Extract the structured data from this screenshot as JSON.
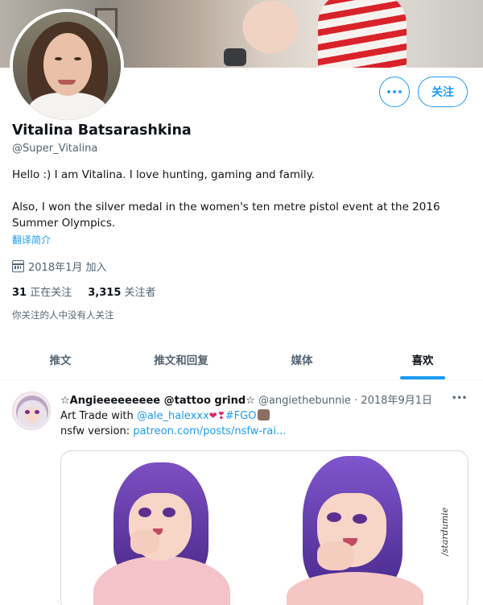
{
  "profile": {
    "name": "Vitalina Batsarashkina",
    "handle": "@Super_Vitalina",
    "bio_line1": "Hello :) I am Vitalina. I love hunting, gaming and family.",
    "bio_line2": "Also, I won the silver medal in the women's ten metre pistol event at the 2016 Summer Olympics.",
    "translate_label": "翻译简介",
    "joined": "2018年1月 加入",
    "following_count": "31",
    "following_label": "正在关注",
    "followers_count": "3,315",
    "followers_label": "关注者",
    "followed_by_none": "你关注的人中没有人关注"
  },
  "actions": {
    "more_label": "•••",
    "follow_label": "关注"
  },
  "tabs": [
    {
      "label": "推文",
      "active": false
    },
    {
      "label": "推文和回复",
      "active": false
    },
    {
      "label": "媒体",
      "active": false
    },
    {
      "label": "喜欢",
      "active": true
    }
  ],
  "tweet": {
    "author_name": "☆Angieeeeeeeee @tattoo grind☆",
    "author_handle": "@angiethebunnie",
    "separator": "·",
    "date": "2018年9月1日",
    "more_label": "•••",
    "text_prefix": "Art Trade with ",
    "mention": "@ale_halexxx",
    "hashtag": "#FGO",
    "nsfw_prefix": "nsfw version: ",
    "link": "patreon.com/posts/nsfw-rai...",
    "signature": "/stardumie"
  },
  "colors": {
    "accent": "#1d9bf0",
    "text_primary": "#0f1419",
    "text_secondary": "#536471"
  }
}
